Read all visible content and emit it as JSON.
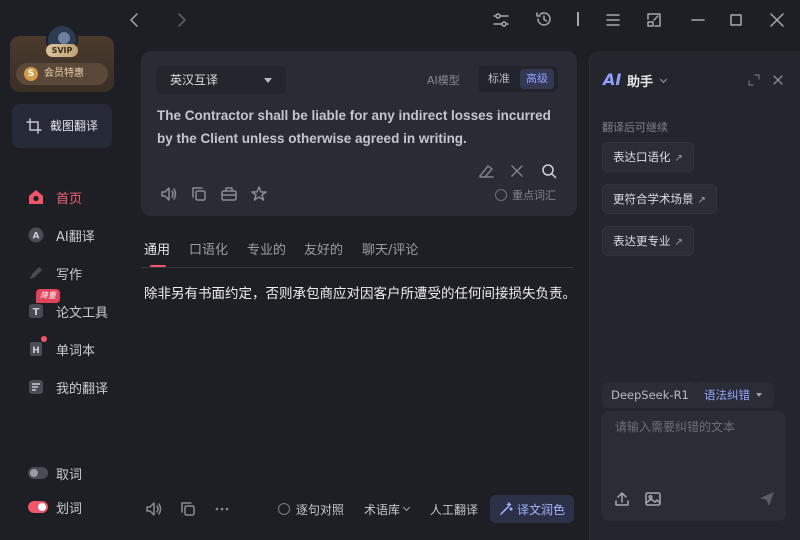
{
  "sidebar": {
    "vip_badge": "SVIP",
    "vip_offer": "会员特惠",
    "vip_coin": "S",
    "screenshot_translate": "截图翻译",
    "nav": [
      {
        "label": "首页",
        "icon": "home-icon",
        "active": true
      },
      {
        "label": "AI翻译",
        "icon": "ai-translate-icon",
        "active": false
      },
      {
        "label": "写作",
        "icon": "pen-icon",
        "active": false
      },
      {
        "label": "论文工具",
        "icon": "paper-tool-icon",
        "active": false
      },
      {
        "label": "单词本",
        "icon": "wordbook-icon",
        "active": false
      },
      {
        "label": "我的翻译",
        "icon": "my-translation-icon",
        "active": false
      }
    ],
    "paper_badge": "降重",
    "toggles": [
      {
        "label": "取词",
        "on": false
      },
      {
        "label": "划词",
        "on": true
      }
    ]
  },
  "source": {
    "language": "英汉互译",
    "ai_model_label": "AI模型",
    "mode_standard": "标准",
    "mode_advanced": "高级",
    "text": "The Contractor shall be liable for any indirect losses incurred by the Client unless otherwise agreed in writing.",
    "keyword_label": "重点词汇"
  },
  "tabs": [
    "通用",
    "口语化",
    "专业的",
    "友好的",
    "聊天/评论"
  ],
  "result": {
    "text": "除非另有书面约定，否则承包商应对因客户所遭受的任何间接损失负责。"
  },
  "bottom_bar": {
    "sentence_compare": "逐句对照",
    "glossary": "术语库",
    "human_translate": "人工翻译",
    "polish": "译文润色"
  },
  "assistant": {
    "logo": "AI",
    "title": "助手",
    "continue_hint": "翻译后可继续",
    "suggestions": [
      "表达口语化",
      "更符合学术场景",
      "表达更专业"
    ],
    "model": "DeepSeek-R1",
    "grammar": "语法纠错",
    "input_placeholder": "请输入需要纠错的文本"
  },
  "colors": {
    "accent_red": "#f0566a",
    "accent_blue": "#8ea3ff",
    "background": "#1e1f25",
    "card": "#2a2c35"
  }
}
